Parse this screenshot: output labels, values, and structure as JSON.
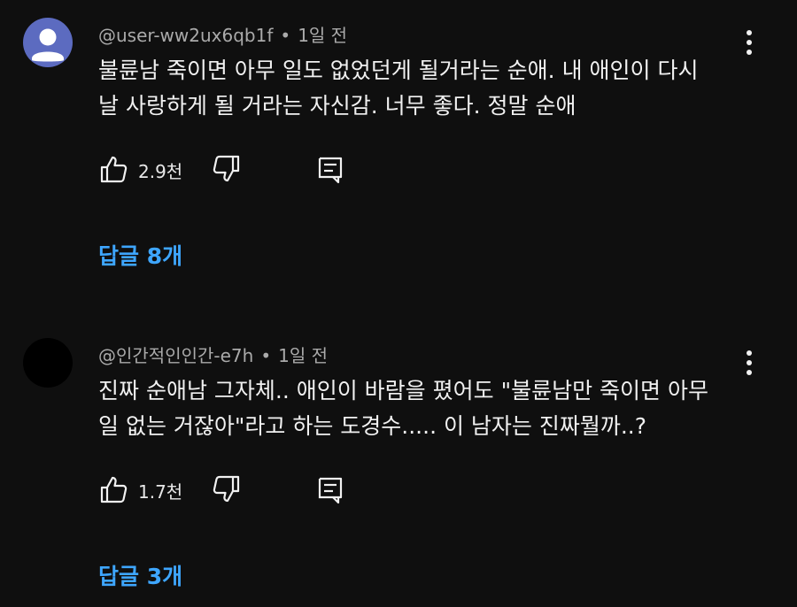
{
  "comments": [
    {
      "author": "@user-ww2ux6qb1f",
      "time": "1일 전",
      "avatar": "default-user-avatar",
      "text_lines": [
        "불륜남 죽이면 아무 일도 없었던게 될거라는 순애. 내 애인이 다시",
        "날 사랑하게 될 거라는 자신감. 너무 좋다. 정말 순애"
      ],
      "likes": "2.9천",
      "replies_label": "답글 8개"
    },
    {
      "author": "@인간적인인간-e7h",
      "time": "1일 전",
      "avatar": "black-avatar",
      "text_lines": [
        "진짜 순애남 그자체.. 애인이 바람을 폈어도 \"불륜남만 죽이면 아무",
        "일 없는 거잖아\"라고 하는 도경수..... 이 남자는 진짜뭘까..?"
      ],
      "likes": "1.7천",
      "replies_label": "답글 3개"
    }
  ],
  "meta_separator": "•",
  "icons": {
    "more": "more-vert-icon",
    "like": "thumb-up-icon",
    "dislike": "thumb-down-icon",
    "reply": "comment-icon"
  },
  "colors": {
    "background": "#0f0f0f",
    "text": "#f1f1f1",
    "meta": "#aaaaaa",
    "link": "#3ea6ff",
    "avatar_default": "#5c6bc0"
  }
}
